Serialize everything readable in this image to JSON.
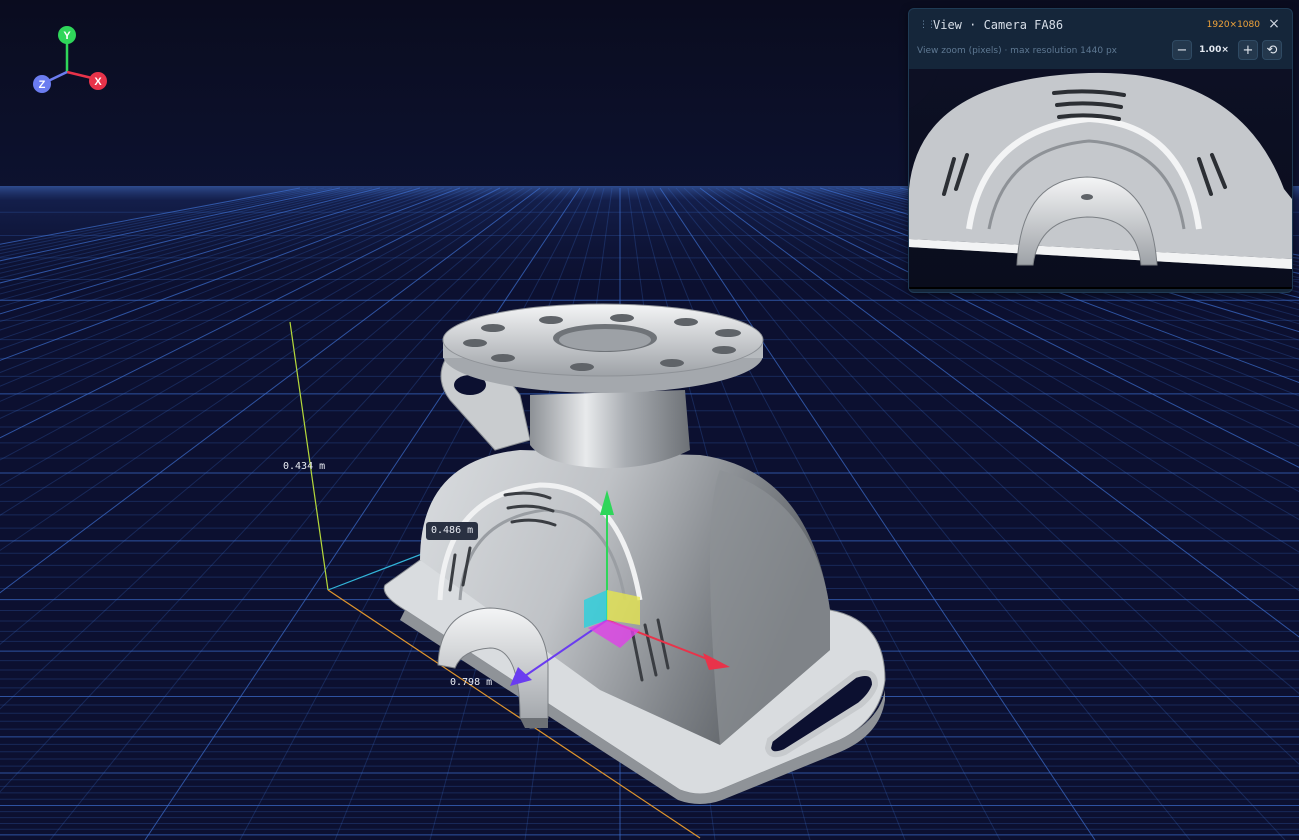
{
  "axis_gizmo": {
    "y_label": "Y",
    "x_label": "X",
    "z_label": "Z"
  },
  "dimensions": {
    "height": "0.434 m",
    "depth": "0.486 m",
    "width": "0.798 m"
  },
  "camera_panel": {
    "title": "View · Camera FA86",
    "resolution": "1920×1080",
    "close_glyph": "×",
    "subtitle": "View zoom (pixels) · max resolution 1440 px",
    "zoom_out_glyph": "−",
    "zoom_value": "1.00×",
    "zoom_in_glyph": "+",
    "reset_glyph": "⟲"
  },
  "colors": {
    "background": "#0b0e22",
    "grid": "#3d6fd0",
    "axis_x": "#e8334a",
    "axis_y": "#2fd65a",
    "axis_z": "#6b7cf0",
    "accent_orange": "#f0a43a",
    "panel_bg": "#15263a"
  }
}
